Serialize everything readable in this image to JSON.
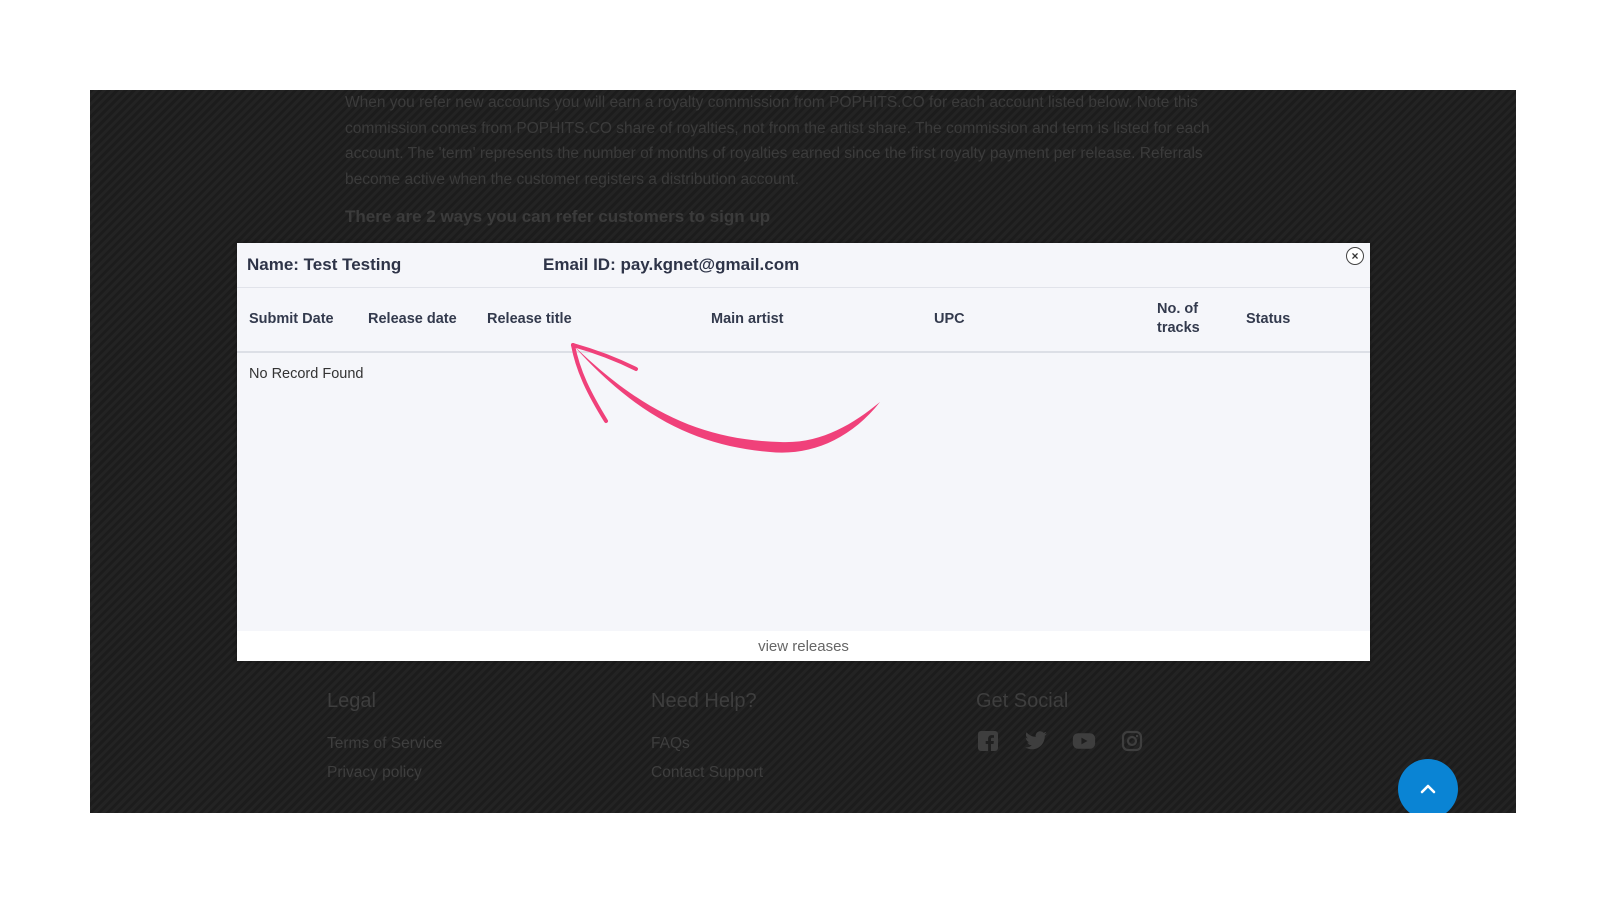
{
  "background": {
    "paragraph": "When you refer new accounts you will earn a royalty commission from POPHITS.CO for each account listed below. Note this commission comes from POPHITS.CO share of royalties, not from the artist share. The commission and term is listed for each account. The 'term' represents the number of months of royalties earned since the first royalty payment per release. Referrals become active when the customer registers a distribution account.",
    "subheading": "There are 2 ways you can refer customers to sign up",
    "footer": {
      "legal": {
        "title": "Legal",
        "links": [
          "Terms of Service",
          "Privacy policy"
        ]
      },
      "help": {
        "title": "Need Help?",
        "links": [
          "FAQs",
          "Contact Support"
        ]
      },
      "social": {
        "title": "Get Social",
        "icons": [
          "facebook-icon",
          "twitter-icon",
          "youtube-icon",
          "instagram-icon"
        ]
      }
    }
  },
  "modal": {
    "name_label": "Name: Test Testing",
    "email_label": "Email ID: pay.kgnet@gmail.com",
    "close_symbol": "×",
    "columns": [
      "Submit Date",
      "Release date",
      "Release title",
      "Main artist",
      "UPC",
      "No. of tracks",
      "Status"
    ],
    "empty_message": "No Record Found",
    "footer_link": "view releases"
  },
  "colors": {
    "accent": "#0a84d4",
    "annotation_arrow": "#f0417a",
    "modal_bg": "#f5f6fa"
  }
}
